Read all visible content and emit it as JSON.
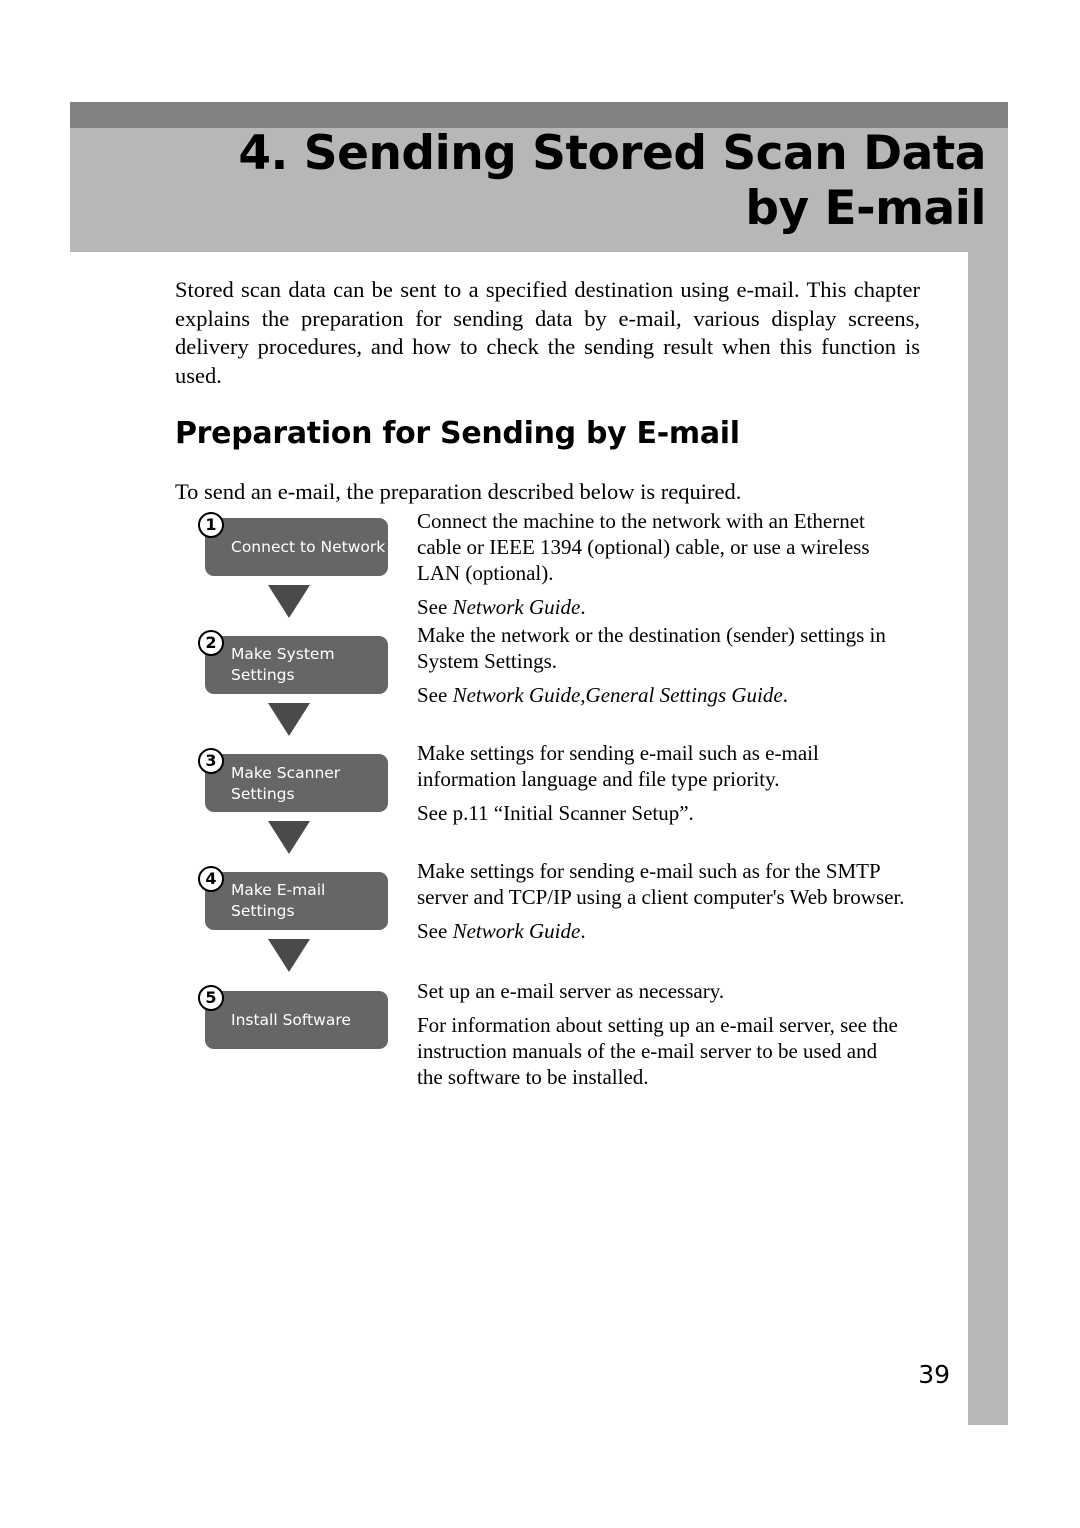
{
  "document": {
    "page_number": "39"
  },
  "chapter_header": {
    "title": "4. Sending Stored Scan Data\nby E-mail",
    "band_color": "#828282",
    "background_color": "#b7b7b7"
  },
  "body": {
    "intro": "Stored scan data can be sent to a specified destination using e-mail. This chapter explains the preparation for sending data by e-mail, various display screens, delivery procedures, and how to check the sending result when this function is used.",
    "section_heading": "Preparation for Sending by E-mail",
    "lead_line": "To send an e-mail, the preparation described below is required."
  },
  "flowchart": {
    "box_color": "#666666",
    "arrow_color": "#4a4a4a",
    "steps": [
      {
        "number": "1",
        "box_label": "Connect to Network",
        "description": "Connect the machine to the network with an Ethernet cable or IEEE 1394 (optional) cable, or use a wireless LAN (optional).",
        "reference_prefix": "See ",
        "reference_italic": "Network Guide",
        "reference_suffix": "."
      },
      {
        "number": "2",
        "box_label": "Make System Settings",
        "description": "Make the network or the destination (sender) settings in System Settings.",
        "reference_prefix": "See ",
        "reference_italic": "Network Guide,General Settings Guide",
        "reference_suffix": "."
      },
      {
        "number": "3",
        "box_label": "Make Scanner\nSettings",
        "description": "Make settings for sending e-mail such as e-mail information language and file type priority.",
        "reference_prefix": "See p.11 “Initial Scanner Setup”.",
        "reference_italic": "",
        "reference_suffix": ""
      },
      {
        "number": "4",
        "box_label": "Make E-mail Settings",
        "description": "Make settings for sending e-mail such as for the SMTP server and TCP/IP using a client computer's Web browser.",
        "reference_prefix": "See ",
        "reference_italic": "Network Guide",
        "reference_suffix": "."
      },
      {
        "number": "5",
        "box_label": "Install Software",
        "description": "Set up an e-mail server as necessary.",
        "reference_prefix": "For information about setting up an e-mail server, see the instruction manuals of the e-mail server to be used and the software to be installed.",
        "reference_italic": "",
        "reference_suffix": ""
      }
    ]
  }
}
